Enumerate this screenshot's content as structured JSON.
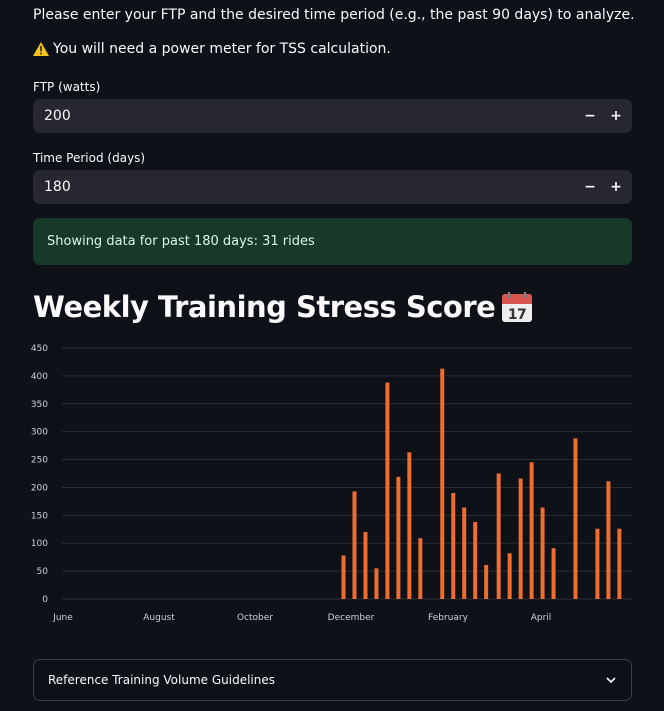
{
  "intro_text": "Please enter your FTP and the desired time period (e.g., the past 90 days) to analyze.",
  "warning": {
    "icon": "warning-icon",
    "text": "You will need a power meter for TSS calculation."
  },
  "ftp": {
    "label": "FTP (watts)",
    "value": "200",
    "minus": "−",
    "plus": "+"
  },
  "period": {
    "label": "Time Period (days)",
    "value": "180",
    "minus": "−",
    "plus": "+"
  },
  "status": {
    "text": "Showing data for past 180 days: 31 rides",
    "color": "#173928"
  },
  "heading": {
    "text": "Weekly Training Stress Score",
    "icon": "calendar-icon"
  },
  "expander": {
    "label": "Reference Training Volume Guidelines",
    "icon": "chevron-down-icon"
  },
  "colors": {
    "bar": "#ee6d2f",
    "background": "#0e1117",
    "input_bg": "#262730"
  },
  "chart_data": {
    "type": "bar",
    "title": "",
    "xlabel": "",
    "ylabel": "",
    "ylim": [
      0,
      450
    ],
    "y_ticks": [
      0,
      50,
      100,
      150,
      200,
      250,
      300,
      350,
      400,
      450
    ],
    "x_ticks": [
      "June",
      "August",
      "October",
      "December",
      "February",
      "April"
    ],
    "grid": true,
    "series": [
      {
        "values": [
          {
            "week": "Nov 27",
            "tss": 78
          },
          {
            "week": "Dec 04",
            "tss": 193
          },
          {
            "week": "Dec 11",
            "tss": 120
          },
          {
            "week": "Dec 18",
            "tss": 55
          },
          {
            "week": "Dec 25",
            "tss": 388
          },
          {
            "week": "Jan 01",
            "tss": 219
          },
          {
            "week": "Jan 08",
            "tss": 263
          },
          {
            "week": "Jan 15",
            "tss": 109
          },
          {
            "week": "Jan 29",
            "tss": 413
          },
          {
            "week": "Feb 05",
            "tss": 190
          },
          {
            "week": "Feb 12",
            "tss": 164
          },
          {
            "week": "Feb 19",
            "tss": 138
          },
          {
            "week": "Feb 26",
            "tss": 61
          },
          {
            "week": "Mar 05",
            "tss": 225
          },
          {
            "week": "Mar 12",
            "tss": 82
          },
          {
            "week": "Mar 19",
            "tss": 216
          },
          {
            "week": "Mar 26",
            "tss": 245
          },
          {
            "week": "Apr 02",
            "tss": 164
          },
          {
            "week": "Apr 09",
            "tss": 91
          },
          {
            "week": "Apr 23",
            "tss": 288
          },
          {
            "week": "May 07",
            "tss": 126
          },
          {
            "week": "May 14",
            "tss": 211
          },
          {
            "week": "May 21",
            "tss": 126
          }
        ]
      }
    ]
  }
}
